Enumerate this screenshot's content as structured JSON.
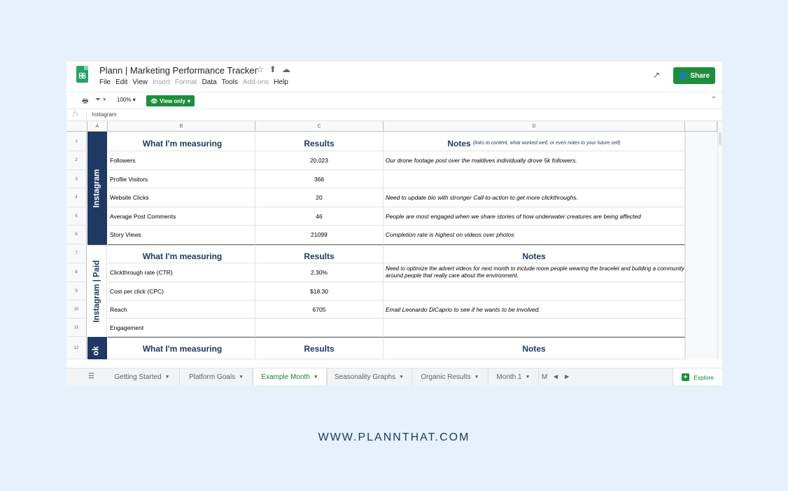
{
  "window": {
    "title": "Plann | Marketing Performance Tracker",
    "menu": [
      "File",
      "Edit",
      "View",
      "Insert",
      "Format",
      "Data",
      "Tools",
      "Add-ons",
      "Help"
    ],
    "menu_disabled": [
      "Insert",
      "Format",
      "Add-ons"
    ],
    "share_label": "Share"
  },
  "toolbar": {
    "zoom": "100%",
    "view_only_label": "View only"
  },
  "formula_bar": {
    "fx": "fx",
    "value": "Instagram"
  },
  "columns": [
    "A",
    "B",
    "C",
    "D"
  ],
  "row_numbers": [
    "1",
    "2",
    "3",
    "4",
    "5",
    "6",
    "7",
    "8",
    "9",
    "10",
    "11",
    "12"
  ],
  "sections": {
    "instagram": {
      "label": "Instagram",
      "header": {
        "measure": "What I'm measuring",
        "results": "Results",
        "notes": "Notes",
        "notes_hint": "(links to content, what worked well, or even notes to your future self)"
      },
      "rows": [
        {
          "measure": "Followers",
          "result": "20,023",
          "note": "Our drone footage post over the maldives individually drove 5k followers."
        },
        {
          "measure": "Profile Visitors",
          "result": "366",
          "note": ""
        },
        {
          "measure": "Website Clicks",
          "result": "20",
          "note": "Need to update bio with stronger Call-to-action to get more clickthroughs."
        },
        {
          "measure": "Average Post Comments",
          "result": "46",
          "note": "People are most engaged when we share stories of how underwater creatures are being affected"
        },
        {
          "measure": "Story Views",
          "result": "21099",
          "note": "Completion rate is highest on videos over photos"
        }
      ]
    },
    "instagram_paid": {
      "label": "Instagram | Paid",
      "header": {
        "measure": "What I'm measuring",
        "results": "Results",
        "notes": "Notes"
      },
      "rows": [
        {
          "measure": "Clickthrough rate (CTR)",
          "result": "2.30%",
          "note": "Need to optimize the advert videos for next month to include more people wearing the bracelet and building a community around people that really care about the environment."
        },
        {
          "measure": "Cost per click (CPC)",
          "result": "$18.30",
          "note": ""
        },
        {
          "measure": "Reach",
          "result": "6705",
          "note": "Email Leonardo DiCaprio to see if he wants to be involved."
        },
        {
          "measure": "Engagement",
          "result": "",
          "note": ""
        }
      ]
    },
    "next": {
      "label": "ok",
      "header": {
        "measure": "What I'm measuring",
        "results": "Results",
        "notes": "Notes"
      }
    }
  },
  "tabs": [
    {
      "label": "Getting Started",
      "active": false
    },
    {
      "label": "Platform Goals",
      "active": false
    },
    {
      "label": "Example Month",
      "active": true
    },
    {
      "label": "Seasonality Graphs",
      "active": false
    },
    {
      "label": "Organic Results",
      "active": false
    },
    {
      "label": "Month 1",
      "active": false
    },
    {
      "label": "M",
      "active": false
    }
  ],
  "explore_label": "Explore",
  "footer_url": "WWW.PLANNTHAT.COM",
  "colors": {
    "background": "#e6f1fb",
    "brand_green": "#1e8e3e",
    "section_navy": "#1f3864"
  }
}
